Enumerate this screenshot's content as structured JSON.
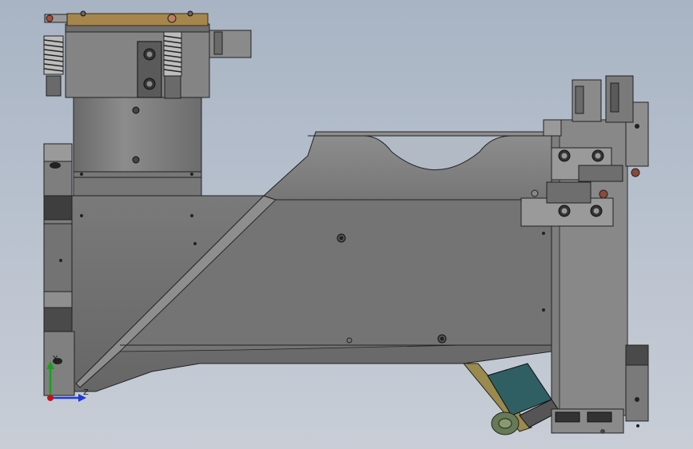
{
  "view": {
    "background_top": "#a8b4c4",
    "background_bottom": "#c8cdd6"
  },
  "triad": {
    "y_label": "Y",
    "z_label": "Z",
    "y_color": "#1aa01a",
    "z_color": "#1f3bd6",
    "origin_color": "#c0141c"
  },
  "model": {
    "body_color": "#707070",
    "dark_color": "#4c4c4c",
    "light_color": "#8a8a8a",
    "brass_color": "#a6864c",
    "teal_color": "#2f5f63"
  }
}
